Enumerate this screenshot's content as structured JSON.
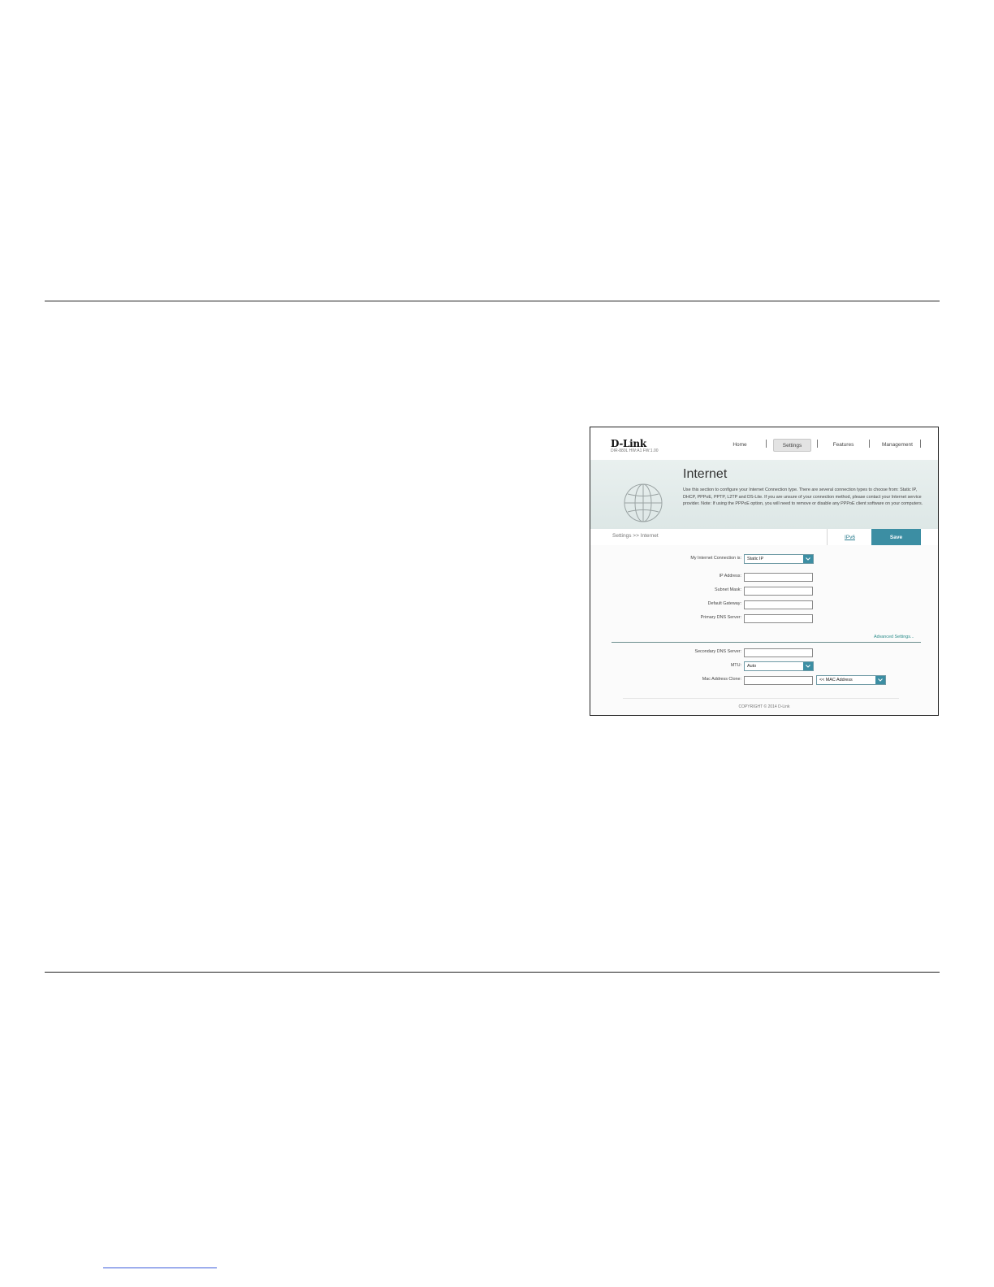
{
  "router_ui": {
    "brand": "D-Link",
    "model_info": "DIR-880L   HW:A1   FW:1.00",
    "nav": [
      {
        "label": "Home"
      },
      {
        "label": "Settings"
      },
      {
        "label": "Features"
      },
      {
        "label": "Management"
      }
    ],
    "page_title": "Internet",
    "page_description": "Use this section to configure your Internet Connection type. There are several connection types to choose from: Static IP, DHCP, PPPoE, PPTP, L2TP and DS-Lite. If you are unsure of your connection method, please contact your Internet service provider. Note: If using the PPPoE option, you will need to remove or disable any PPPoE client software on your computers.",
    "breadcrumb": "Settings >> Internet",
    "ipv6_link": "IPv6",
    "save_label": "Save",
    "form": {
      "connection_label": "My Internet Connection is:",
      "connection_value": "Static IP",
      "ip_address_label": "IP Address:",
      "subnet_mask_label": "Subnet Mask:",
      "default_gateway_label": "Default Gateway:",
      "primary_dns_label": "Primary DNS Server:",
      "advanced_settings_link": "Advanced Settings...",
      "secondary_dns_label": "Secondary DNS Server:",
      "mtu_label": "MTU:",
      "mtu_value": "Auto",
      "mac_clone_label": "Mac Address Clone:",
      "mac_select_value": "<< MAC Address"
    },
    "copyright": "COPYRIGHT © 2014 D-Link",
    "accent_color": "#3c8ea3"
  }
}
